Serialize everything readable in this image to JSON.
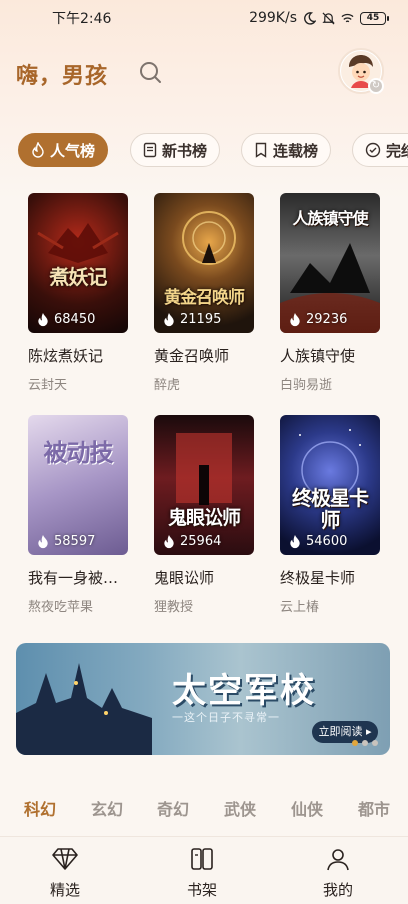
{
  "status_bar": {
    "time": "下午2:46",
    "network_speed": "299K/s",
    "icons": [
      "moon-icon",
      "mute-icon",
      "wifi-icon"
    ],
    "battery": "45"
  },
  "header": {
    "greeting": "嗨，男孩",
    "search_icon": "search-icon",
    "avatar_icon": "avatar-icon"
  },
  "tabs": [
    {
      "label": "人气榜",
      "icon": "flame-icon",
      "active": true
    },
    {
      "label": "新书榜",
      "icon": "book-icon",
      "active": false
    },
    {
      "label": "连载榜",
      "icon": "bookmark-icon",
      "active": false
    },
    {
      "label": "完结榜",
      "icon": "check-icon",
      "active": false
    }
  ],
  "books": [
    {
      "title": "陈炫煮妖记",
      "author": "云封天",
      "count": "68450",
      "cover_text": "煮妖记",
      "colors": [
        "#3a0f0a",
        "#8a1c12"
      ]
    },
    {
      "title": "黄金召唤师",
      "author": "醉虎",
      "count": "21195",
      "cover_text": "黄金召唤师",
      "colors": [
        "#1f140c",
        "#7a4a1e"
      ]
    },
    {
      "title": "人族镇守使",
      "author": "白驹易逝",
      "count": "29236",
      "cover_text": "人族镇守使",
      "colors": [
        "#141414",
        "#5a5a5a"
      ]
    },
    {
      "title": "我有一身被动技",
      "author": "熬夜吃苹果",
      "count": "58597",
      "cover_text": "被动技",
      "colors": [
        "#cdbfdb",
        "#8d7bb2"
      ]
    },
    {
      "title": "鬼眼讼师",
      "author": "狸教授",
      "count": "25964",
      "cover_text": "鬼眼讼师",
      "colors": [
        "#2a0c10",
        "#8e2a2a"
      ]
    },
    {
      "title": "终极星卡师",
      "author": "云上椿",
      "count": "54600",
      "cover_text": "终极星卡师",
      "colors": [
        "#0b1030",
        "#2c3a8a"
      ]
    }
  ],
  "banner": {
    "title": "太空军校",
    "subtitle": "一这个日子不寻常一",
    "button": "立即阅读"
  },
  "categories": [
    "科幻",
    "玄幻",
    "奇幻",
    "武侠",
    "仙侠",
    "都市"
  ],
  "active_category": 0,
  "nav": [
    {
      "label": "精选",
      "icon": "diamond-icon"
    },
    {
      "label": "书架",
      "icon": "bookshelf-icon"
    },
    {
      "label": "我的",
      "icon": "profile-icon"
    }
  ]
}
